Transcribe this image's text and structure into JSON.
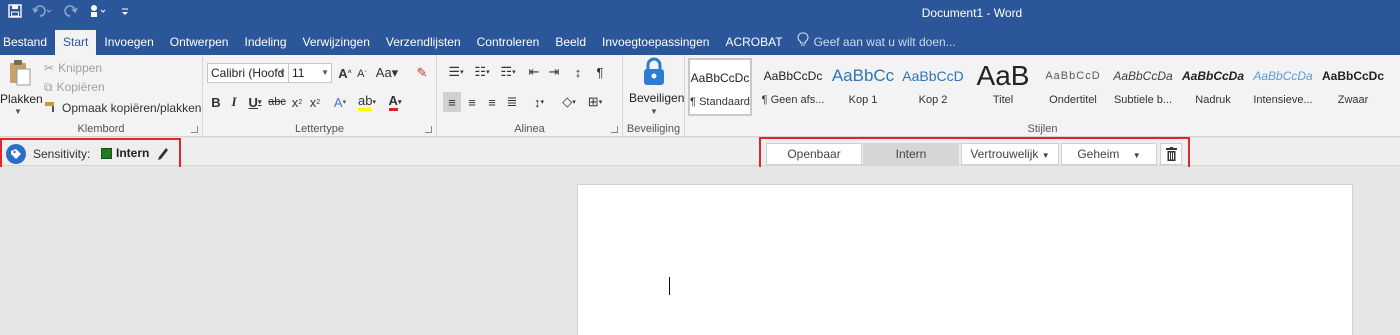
{
  "title_bar": {
    "document_title": "Document1 - Word"
  },
  "tabs": [
    {
      "label": "Bestand",
      "active": false
    },
    {
      "label": "Start",
      "active": true
    },
    {
      "label": "Invoegen",
      "active": false
    },
    {
      "label": "Ontwerpen",
      "active": false
    },
    {
      "label": "Indeling",
      "active": false
    },
    {
      "label": "Verwijzingen",
      "active": false
    },
    {
      "label": "Verzendlijsten",
      "active": false
    },
    {
      "label": "Controleren",
      "active": false
    },
    {
      "label": "Beeld",
      "active": false
    },
    {
      "label": "Invoegtoepassingen",
      "active": false
    },
    {
      "label": "ACROBAT",
      "active": false
    }
  ],
  "tell_me": "Geef aan wat u wilt doen...",
  "clipboard": {
    "paste_label": "Plakken",
    "cut_label": "Knippen",
    "copy_label": "Kopiëren",
    "format_painter_label": "Opmaak kopiëren/plakken",
    "group_label": "Klembord"
  },
  "font": {
    "font_name": "Calibri (Hoofd",
    "font_size": "11",
    "group_label": "Lettertype"
  },
  "paragraph": {
    "group_label": "Alinea"
  },
  "protect": {
    "button_label": "Beveiligen",
    "group_label": "Beveiliging"
  },
  "styles": {
    "group_label": "Stijlen",
    "items": [
      {
        "sample": "AaBbCcDc",
        "name": "¶ Standaard",
        "selected": true
      },
      {
        "sample": "AaBbCcDc",
        "name": "¶ Geen afs...",
        "selected": false
      },
      {
        "sample": "AaBbCc",
        "name": "Kop 1",
        "selected": false
      },
      {
        "sample": "AaBbCcD",
        "name": "Kop 2",
        "selected": false
      },
      {
        "sample": "AaB",
        "name": "Titel",
        "selected": false
      },
      {
        "sample": "AaBbCcD",
        "name": "Ondertitel",
        "selected": false
      },
      {
        "sample": "AaBbCcDa",
        "name": "Subtiele b...",
        "selected": false
      },
      {
        "sample": "AaBbCcDa",
        "name": "Nadruk",
        "selected": false
      },
      {
        "sample": "AaBbCcDa",
        "name": "Intensieve...",
        "selected": false
      },
      {
        "sample": "AaBbCcDc",
        "name": "Zwaar",
        "selected": false
      }
    ]
  },
  "sensitivity": {
    "label": "Sensitivity:",
    "current": "Intern",
    "current_color": "#1e7b1e",
    "buttons": [
      {
        "label": "Openbaar",
        "active": false
      },
      {
        "label": "Intern",
        "active": true
      },
      {
        "label": "Vertrouwelijk",
        "active": false,
        "dropdown": true
      },
      {
        "label": "Geheim",
        "active": false,
        "dropdown": true
      }
    ]
  },
  "colors": {
    "brand": "#2b579a",
    "highlight_box": "#e2252c"
  }
}
